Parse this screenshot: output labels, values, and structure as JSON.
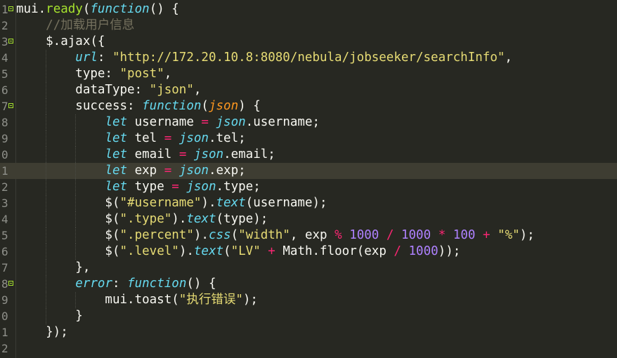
{
  "editor": {
    "theme_colors": {
      "background": "#272822",
      "current_line": "#3e3d32",
      "keyword": "#66d9ef",
      "function": "#a6e22e",
      "string": "#e6db74",
      "operator": "#f92672",
      "number": "#ae81ff",
      "comment": "#75715e",
      "parameter": "#fd971f"
    },
    "line_numbers": [
      "1",
      "2",
      "3",
      "4",
      "5",
      "6",
      "7",
      "8",
      "9",
      "0",
      "1",
      "2",
      "3",
      "4",
      "5",
      "6",
      "7",
      "8",
      "9",
      "0",
      "1",
      "2"
    ],
    "highlighted_line_index": 10,
    "fold_marker_lines": [
      0,
      2,
      6,
      17
    ],
    "lines": [
      [
        {
          "c": "plain",
          "t": "mui."
        },
        {
          "c": "fn",
          "t": "ready"
        },
        {
          "c": "plain",
          "t": "("
        },
        {
          "c": "kw",
          "t": "function"
        },
        {
          "c": "plain",
          "t": "() {"
        }
      ],
      [
        {
          "c": "plain",
          "t": "    "
        },
        {
          "c": "cm",
          "t": "//加载用户信息"
        }
      ],
      [
        {
          "c": "plain",
          "t": "    $.ajax({"
        }
      ],
      [
        {
          "c": "plain",
          "t": "        "
        },
        {
          "c": "ital",
          "t": "url"
        },
        {
          "c": "plain",
          "t": ": "
        },
        {
          "c": "str",
          "t": "\"http://172.20.10.8:8080/nebula/jobseeker/searchInfo\""
        },
        {
          "c": "plain",
          "t": ","
        }
      ],
      [
        {
          "c": "plain",
          "t": "        type: "
        },
        {
          "c": "str",
          "t": "\"post\""
        },
        {
          "c": "plain",
          "t": ","
        }
      ],
      [
        {
          "c": "plain",
          "t": "        dataType: "
        },
        {
          "c": "str",
          "t": "\"json\""
        },
        {
          "c": "plain",
          "t": ","
        }
      ],
      [
        {
          "c": "plain",
          "t": "        success: "
        },
        {
          "c": "kw",
          "t": "function"
        },
        {
          "c": "plain",
          "t": "("
        },
        {
          "c": "param",
          "t": "json"
        },
        {
          "c": "plain",
          "t": ") {"
        }
      ],
      [
        {
          "c": "plain",
          "t": "            "
        },
        {
          "c": "kw",
          "t": "let"
        },
        {
          "c": "plain",
          "t": " username "
        },
        {
          "c": "op",
          "t": "="
        },
        {
          "c": "plain",
          "t": " "
        },
        {
          "c": "ital",
          "t": "json"
        },
        {
          "c": "plain",
          "t": ".username;"
        }
      ],
      [
        {
          "c": "plain",
          "t": "            "
        },
        {
          "c": "kw",
          "t": "let"
        },
        {
          "c": "plain",
          "t": " tel "
        },
        {
          "c": "op",
          "t": "="
        },
        {
          "c": "plain",
          "t": " "
        },
        {
          "c": "ital",
          "t": "json"
        },
        {
          "c": "plain",
          "t": ".tel;"
        }
      ],
      [
        {
          "c": "plain",
          "t": "            "
        },
        {
          "c": "kw",
          "t": "let"
        },
        {
          "c": "plain",
          "t": " email "
        },
        {
          "c": "op",
          "t": "="
        },
        {
          "c": "plain",
          "t": " "
        },
        {
          "c": "ital",
          "t": "json"
        },
        {
          "c": "plain",
          "t": ".email;"
        }
      ],
      [
        {
          "c": "plain",
          "t": "            "
        },
        {
          "c": "kw",
          "t": "let"
        },
        {
          "c": "plain",
          "t": " exp "
        },
        {
          "c": "op",
          "t": "="
        },
        {
          "c": "plain",
          "t": " "
        },
        {
          "c": "ital",
          "t": "json"
        },
        {
          "c": "plain",
          "t": ".exp;"
        }
      ],
      [
        {
          "c": "plain",
          "t": "            "
        },
        {
          "c": "kw",
          "t": "let"
        },
        {
          "c": "plain",
          "t": " type "
        },
        {
          "c": "op",
          "t": "="
        },
        {
          "c": "plain",
          "t": " "
        },
        {
          "c": "ital",
          "t": "json"
        },
        {
          "c": "plain",
          "t": ".type;"
        }
      ],
      [
        {
          "c": "plain",
          "t": "            $("
        },
        {
          "c": "str",
          "t": "\"#username\""
        },
        {
          "c": "plain",
          "t": ")."
        },
        {
          "c": "ital",
          "t": "text"
        },
        {
          "c": "plain",
          "t": "(username);"
        }
      ],
      [
        {
          "c": "plain",
          "t": "            $("
        },
        {
          "c": "str",
          "t": "\".type\""
        },
        {
          "c": "plain",
          "t": ")."
        },
        {
          "c": "ital",
          "t": "text"
        },
        {
          "c": "plain",
          "t": "(type);"
        }
      ],
      [
        {
          "c": "plain",
          "t": "            $("
        },
        {
          "c": "str",
          "t": "\".percent\""
        },
        {
          "c": "plain",
          "t": ")."
        },
        {
          "c": "ital",
          "t": "css"
        },
        {
          "c": "plain",
          "t": "("
        },
        {
          "c": "str",
          "t": "\"width\""
        },
        {
          "c": "plain",
          "t": ", exp "
        },
        {
          "c": "op",
          "t": "%"
        },
        {
          "c": "plain",
          "t": " "
        },
        {
          "c": "num-lit",
          "t": "1000"
        },
        {
          "c": "plain",
          "t": " "
        },
        {
          "c": "op",
          "t": "/"
        },
        {
          "c": "plain",
          "t": " "
        },
        {
          "c": "num-lit",
          "t": "1000"
        },
        {
          "c": "plain",
          "t": " "
        },
        {
          "c": "op",
          "t": "*"
        },
        {
          "c": "plain",
          "t": " "
        },
        {
          "c": "num-lit",
          "t": "100"
        },
        {
          "c": "plain",
          "t": " "
        },
        {
          "c": "op",
          "t": "+"
        },
        {
          "c": "plain",
          "t": " "
        },
        {
          "c": "str",
          "t": "\"%\""
        },
        {
          "c": "plain",
          "t": ");"
        }
      ],
      [
        {
          "c": "plain",
          "t": "            $("
        },
        {
          "c": "str",
          "t": "\".level\""
        },
        {
          "c": "plain",
          "t": ")."
        },
        {
          "c": "ital",
          "t": "text"
        },
        {
          "c": "plain",
          "t": "("
        },
        {
          "c": "str",
          "t": "\"LV\""
        },
        {
          "c": "plain",
          "t": " "
        },
        {
          "c": "op",
          "t": "+"
        },
        {
          "c": "plain",
          "t": " Math.floor(exp "
        },
        {
          "c": "op",
          "t": "/"
        },
        {
          "c": "plain",
          "t": " "
        },
        {
          "c": "num-lit",
          "t": "1000"
        },
        {
          "c": "plain",
          "t": "));"
        }
      ],
      [
        {
          "c": "plain",
          "t": "        },"
        }
      ],
      [
        {
          "c": "plain",
          "t": "        "
        },
        {
          "c": "ital",
          "t": "error"
        },
        {
          "c": "plain",
          "t": ": "
        },
        {
          "c": "kw",
          "t": "function"
        },
        {
          "c": "plain",
          "t": "() {"
        }
      ],
      [
        {
          "c": "plain",
          "t": "            mui.toast("
        },
        {
          "c": "str",
          "t": "\"执行错误\""
        },
        {
          "c": "plain",
          "t": ");"
        }
      ],
      [
        {
          "c": "plain",
          "t": "        }"
        }
      ],
      [
        {
          "c": "plain",
          "t": "    });"
        }
      ],
      [
        {
          "c": "plain",
          "t": ""
        }
      ]
    ]
  }
}
